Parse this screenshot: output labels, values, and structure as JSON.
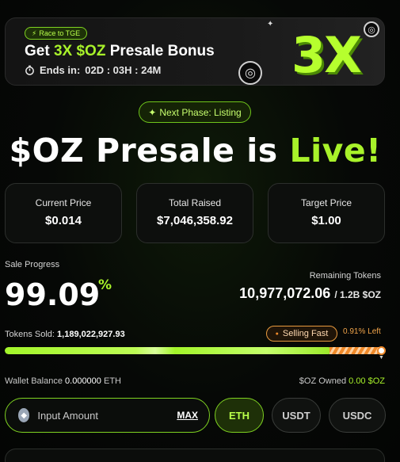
{
  "banner": {
    "race_pill": "Race to TGE",
    "title_pre": "Get ",
    "title_hl": "3X $OZ",
    "title_post": " Presale Bonus",
    "ends_label": "Ends in:",
    "countdown": "02D : 03H : 24M",
    "big_text": "3X"
  },
  "next_phase": "Next Phase: Listing",
  "headline": {
    "main": "$OZ Presale is ",
    "live": "Live!"
  },
  "stats": [
    {
      "label": "Current Price",
      "value": "$0.014"
    },
    {
      "label": "Total Raised",
      "value": "$7,046,358.92"
    },
    {
      "label": "Target Price",
      "value": "$1.00"
    }
  ],
  "progress": {
    "label": "Sale Progress",
    "percent_text": "99.09",
    "percent_sign": "%",
    "percent": 99.09,
    "remaining_label": "Remaining Tokens",
    "remaining_value": "10,977,072.06",
    "remaining_of": "/ 1.2B $OZ",
    "tokens_sold_label": "Tokens Sold:",
    "tokens_sold_value": "1,189,022,927.93",
    "selling_fast": "Selling Fast",
    "left_text": "0.91% Left"
  },
  "wallet": {
    "balance_label": "Wallet Balance",
    "balance_value": "0.000000",
    "balance_unit": "ETH",
    "owned_label": "$OZ Owned",
    "owned_value": "0.00 $OZ"
  },
  "input": {
    "placeholder": "Input Amount",
    "max_label": "MAX"
  },
  "currencies": [
    "ETH",
    "USDT",
    "USDC"
  ],
  "colors": {
    "accent": "#a8f22a",
    "warning": "#f08a2a",
    "background": "#050705"
  }
}
